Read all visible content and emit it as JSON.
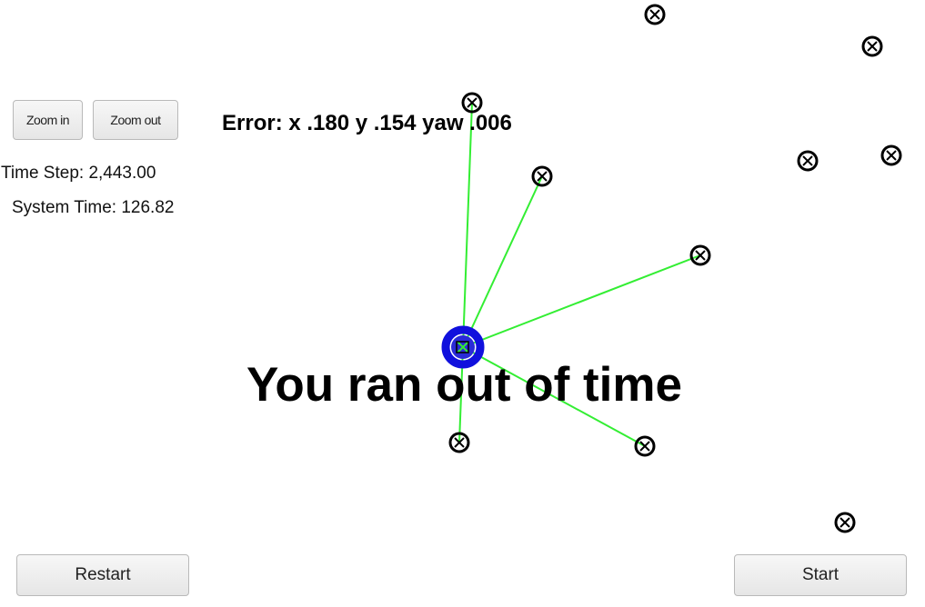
{
  "controls": {
    "zoom_in_label": "Zoom in",
    "zoom_out_label": "Zoom out",
    "restart_label": "Restart",
    "start_label": "Start"
  },
  "stats": {
    "time_step": "Time Step: 2,443.00",
    "system_time": "System Time: 126.82"
  },
  "error_readout": "Error: x .180 y .154 yaw .006",
  "status_message": "You ran out of time",
  "colors": {
    "observation_line": "#33ee33",
    "vehicle": "#1010dd",
    "landmark": "#000000",
    "background": "#ffffff"
  },
  "icons": {
    "landmark": "landmark-marker-icon",
    "vehicle": "vehicle-icon"
  }
}
